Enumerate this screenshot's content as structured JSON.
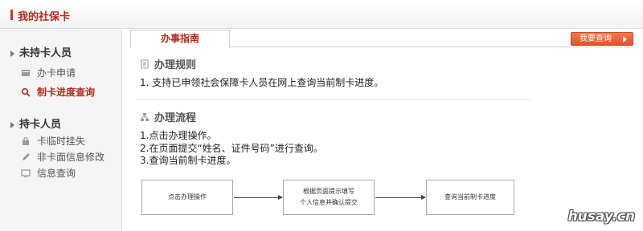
{
  "header": {
    "title": "我的社保卡"
  },
  "sidebar": {
    "sections": [
      {
        "title": "未持卡人员",
        "items": [
          {
            "label": "办卡申请",
            "icon": "card-icon"
          },
          {
            "label": "制卡进度查询",
            "icon": "search-icon",
            "active": true
          }
        ]
      },
      {
        "title": "持卡人员",
        "items": [
          {
            "label": "卡临时挂失",
            "icon": "lock-icon"
          },
          {
            "label": "非卡面信息修改",
            "icon": "pencil-icon"
          },
          {
            "label": "信息查询",
            "icon": "monitor-icon"
          }
        ]
      }
    ]
  },
  "main": {
    "tab_label": "办事指南",
    "action_button": "我要查询",
    "rules": {
      "heading": "办理规则",
      "lines": [
        "1. 支持已申领社会保障卡人员在网上查询当前制卡进度。"
      ]
    },
    "process": {
      "heading": "办理流程",
      "lines": [
        "1.点击办理操作。",
        "2.在页面提交“姓名、证件号码”进行查询。",
        "3.查询当前制卡进度。"
      ]
    },
    "flow": [
      {
        "lines": [
          "点击办理操作"
        ]
      },
      {
        "lines": [
          "根据页面提示填写",
          "个人信息并确认提交"
        ]
      },
      {
        "lines": [
          "查询当前制卡进度"
        ]
      }
    ]
  },
  "watermark": "husay.cn",
  "colors": {
    "accent": "#b52a1c",
    "button": "#e8643a"
  }
}
